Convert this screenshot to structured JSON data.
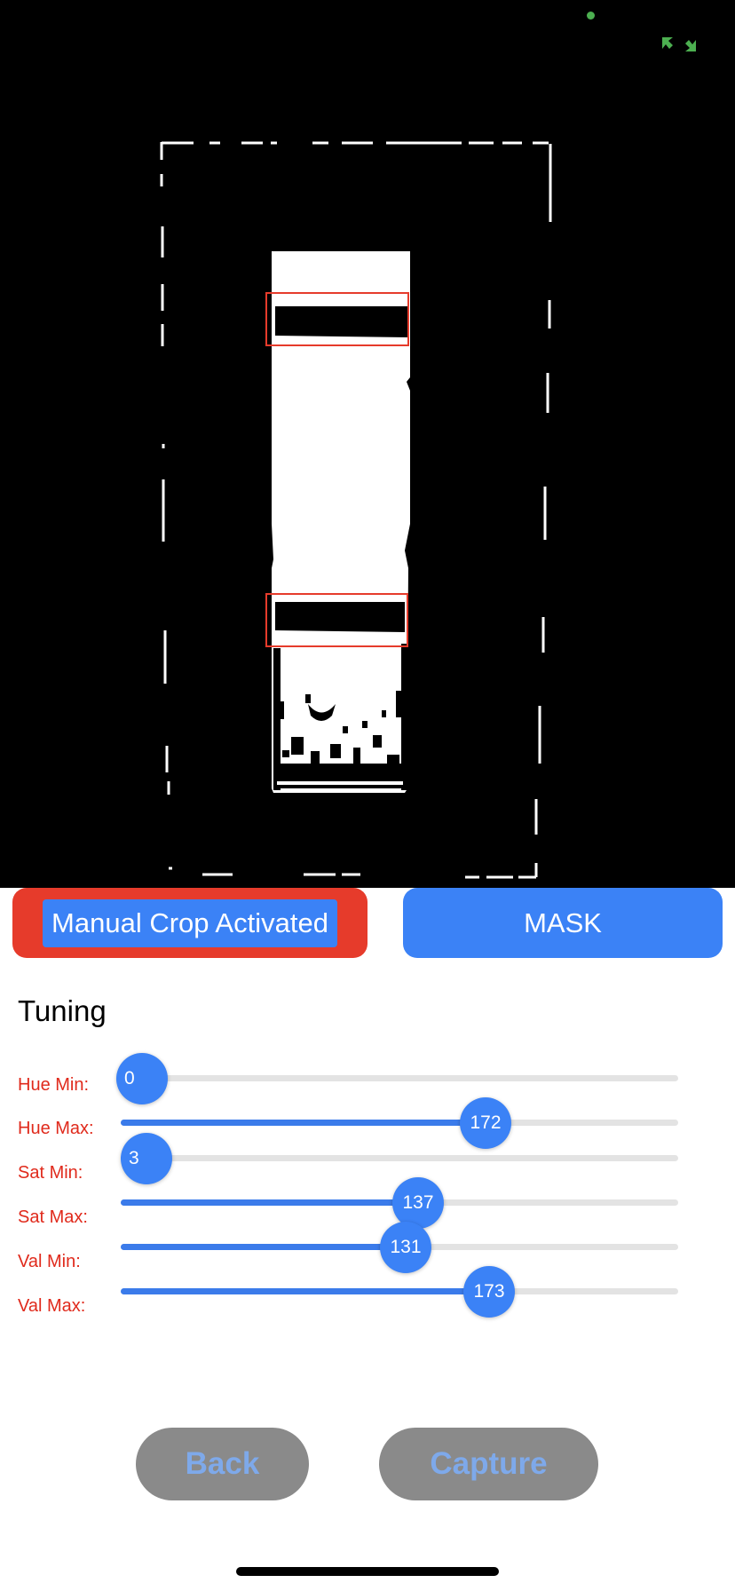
{
  "camera": {
    "status_dot_color": "#4caf50",
    "expand_icon": "expand-arrows-icon",
    "detection_box_color": "#e63b2b",
    "detection_box_count": 2
  },
  "buttons": {
    "manual_crop_label": "Manual Crop Activated",
    "mask_label": "MASK"
  },
  "tuning": {
    "title": "Tuning",
    "sliders": [
      {
        "label": "Hue Min:",
        "value": "0",
        "fraction": 0.0
      },
      {
        "label": "Hue Max:",
        "value": "172",
        "fraction": 0.655
      },
      {
        "label": "Sat Min:",
        "value": "3",
        "fraction": 0.01
      },
      {
        "label": "Sat Max:",
        "value": "137",
        "fraction": 0.535
      },
      {
        "label": "Val Min:",
        "value": "131",
        "fraction": 0.514
      },
      {
        "label": "Val Max:",
        "value": "173",
        "fraction": 0.66
      }
    ]
  },
  "footer": {
    "back_label": "Back",
    "capture_label": "Capture"
  },
  "colors": {
    "accent_blue": "#3b82f6",
    "active_red": "#e63b2b",
    "label_red": "#e02a1c",
    "disabled_gray": "#8a8a8a",
    "disabled_text": "#7ea9ea"
  }
}
